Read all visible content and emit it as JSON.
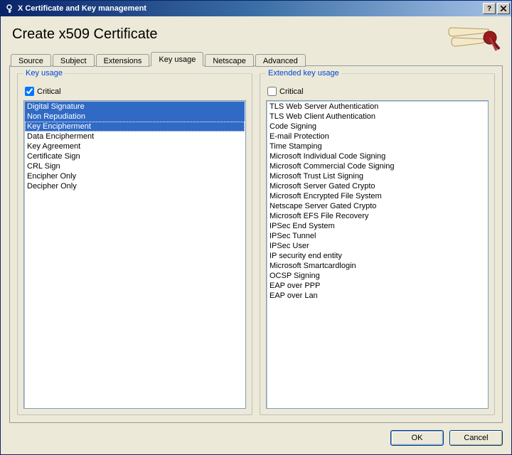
{
  "window": {
    "title": "X Certificate and Key management"
  },
  "heading": "Create x509 Certificate",
  "tabs": {
    "source": "Source",
    "subject": "Subject",
    "extensions": "Extensions",
    "keyusage": "Key usage",
    "netscape": "Netscape",
    "advanced": "Advanced",
    "active": "keyusage"
  },
  "keyUsage": {
    "legend": "Key usage",
    "criticalLabel": "Critical",
    "criticalChecked": true,
    "items": [
      {
        "label": "Digital Signature",
        "selected": true,
        "focus": false
      },
      {
        "label": "Non Repudiation",
        "selected": true,
        "focus": false
      },
      {
        "label": "Key Encipherment",
        "selected": true,
        "focus": true
      },
      {
        "label": "Data Encipherment",
        "selected": false
      },
      {
        "label": "Key Agreement",
        "selected": false
      },
      {
        "label": "Certificate Sign",
        "selected": false
      },
      {
        "label": "CRL Sign",
        "selected": false
      },
      {
        "label": "Encipher Only",
        "selected": false
      },
      {
        "label": "Decipher Only",
        "selected": false
      }
    ]
  },
  "extKeyUsage": {
    "legend": "Extended key usage",
    "criticalLabel": "Critical",
    "criticalChecked": false,
    "items": [
      {
        "label": "TLS Web Server Authentication"
      },
      {
        "label": "TLS Web Client Authentication"
      },
      {
        "label": "Code Signing"
      },
      {
        "label": "E-mail Protection"
      },
      {
        "label": "Time Stamping"
      },
      {
        "label": "Microsoft Individual Code Signing"
      },
      {
        "label": "Microsoft Commercial Code Signing"
      },
      {
        "label": "Microsoft Trust List Signing"
      },
      {
        "label": "Microsoft Server Gated Crypto"
      },
      {
        "label": "Microsoft Encrypted File System"
      },
      {
        "label": "Netscape Server Gated Crypto"
      },
      {
        "label": "Microsoft EFS File Recovery"
      },
      {
        "label": "IPSec End System"
      },
      {
        "label": "IPSec Tunnel"
      },
      {
        "label": "IPSec User"
      },
      {
        "label": "IP security end entity"
      },
      {
        "label": "Microsoft Smartcardlogin"
      },
      {
        "label": "OCSP Signing"
      },
      {
        "label": "EAP over PPP"
      },
      {
        "label": "EAP over Lan"
      }
    ]
  },
  "buttons": {
    "ok": "OK",
    "cancel": "Cancel"
  }
}
